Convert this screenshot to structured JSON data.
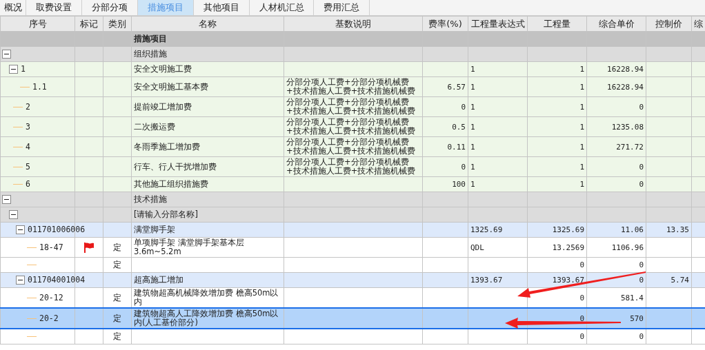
{
  "tabs": [
    {
      "label": "概况",
      "selected": false
    },
    {
      "label": "取费设置",
      "selected": false
    },
    {
      "label": "分部分项",
      "selected": false
    },
    {
      "label": "措施项目",
      "selected": true
    },
    {
      "label": "其他项目",
      "selected": false
    },
    {
      "label": "人材机汇总",
      "selected": false
    },
    {
      "label": "费用汇总",
      "selected": false
    }
  ],
  "table": {
    "columns": [
      "序号",
      "标记",
      "类别",
      "名称",
      "基数说明",
      "费率(%)",
      "工程量表达式",
      "工程量",
      "综合单价",
      "控制价",
      "综"
    ],
    "rows": [
      {
        "kind": "title",
        "name": "措施项目",
        "flagged": false,
        "selected": false
      },
      {
        "kind": "category",
        "name": "组织措施",
        "expanded": true,
        "flagged": false,
        "selected": false,
        "children": [
          {
            "kind": "measure",
            "seq": "1",
            "name": "安全文明施工费",
            "expr": "1",
            "qty": "1",
            "price": "16228.94",
            "expanded": true,
            "flagged": false,
            "selected": false,
            "children": [
              {
                "kind": "measure",
                "seq": "1.1",
                "name": "安全文明施工基本费",
                "base": "分部分项人工费+分部分项机械费+技术措施人工费+技术措施机械费",
                "rate": "6.57",
                "expr": "1",
                "qty": "1",
                "price": "16228.94",
                "flagged": false,
                "selected": false
              }
            ]
          },
          {
            "kind": "measure",
            "seq": "2",
            "name": "提前竣工增加费",
            "base": "分部分项人工费+分部分项机械费+技术措施人工费+技术措施机械费",
            "rate": "0",
            "expr": "1",
            "qty": "1",
            "price": "0",
            "flagged": false,
            "selected": false
          },
          {
            "kind": "measure",
            "seq": "3",
            "name": "二次搬运费",
            "base": "分部分项人工费+分部分项机械费+技术措施人工费+技术措施机械费",
            "rate": "0.5",
            "expr": "1",
            "qty": "1",
            "price": "1235.08",
            "flagged": false,
            "selected": false
          },
          {
            "kind": "measure",
            "seq": "4",
            "name": "冬雨季施工增加费",
            "base": "分部分项人工费+分部分项机械费+技术措施人工费+技术措施机械费",
            "rate": "0.11",
            "expr": "1",
            "qty": "1",
            "price": "271.72",
            "flagged": false,
            "selected": false
          },
          {
            "kind": "measure",
            "seq": "5",
            "name": "行车、行人干扰增加费",
            "base": "分部分项人工费+分部分项机械费+技术措施人工费+技术措施机械费",
            "rate": "0",
            "expr": "1",
            "qty": "1",
            "price": "0",
            "flagged": false,
            "selected": false
          },
          {
            "kind": "measure",
            "seq": "6",
            "name": "其他施工组织措施费",
            "rate": "100",
            "expr": "1",
            "qty": "1",
            "price": "0",
            "flagged": false,
            "selected": false
          }
        ]
      },
      {
        "kind": "category",
        "name": "技术措施",
        "expanded": true,
        "flagged": false,
        "selected": false,
        "children": [
          {
            "kind": "category",
            "name": "[请输入分部名称]",
            "expanded": true,
            "flagged": false,
            "selected": false,
            "children": [
              {
                "kind": "bill",
                "seq": "011701006006",
                "name": "满堂脚手架",
                "expr": "1325.69",
                "qty": "1325.69",
                "price": "11.06",
                "control": "13.35",
                "expanded": true,
                "flagged": false,
                "selected": false,
                "children": [
                  {
                    "kind": "quota",
                    "seq": "18-47",
                    "type": "定",
                    "name": "单项脚手架 满堂脚手架基本层3.6m~5.2m",
                    "expr": "QDL",
                    "qty": "13.2569",
                    "price": "1106.96",
                    "flagged": true,
                    "selected": false
                  },
                  {
                    "kind": "quota",
                    "type": "定",
                    "qty": "0",
                    "price": "0",
                    "flagged": false,
                    "selected": false
                  }
                ]
              },
              {
                "kind": "bill",
                "seq": "011704001004",
                "name": "超高施工增加",
                "expr": "1393.67",
                "qty": "1393.67",
                "price": "0",
                "control": "5.74",
                "expanded": true,
                "flagged": false,
                "selected": false,
                "children": [
                  {
                    "kind": "quota",
                    "seq": "20-12",
                    "type": "定",
                    "name": "建筑物超高机械降效增加费 檐高50m以内",
                    "qty": "0",
                    "price": "581.4",
                    "flagged": false,
                    "selected": false
                  },
                  {
                    "kind": "quota",
                    "seq": "20-2",
                    "type": "定",
                    "name": "建筑物超高人工降效增加费 檐高50m以内(人工基价部分)",
                    "qty": "0",
                    "price": "570",
                    "flagged": false,
                    "selected": true
                  },
                  {
                    "kind": "quota",
                    "type": "定",
                    "qty": "0",
                    "price": "0",
                    "flagged": false,
                    "selected": false
                  }
                ]
              }
            ]
          }
        ]
      }
    ]
  }
}
